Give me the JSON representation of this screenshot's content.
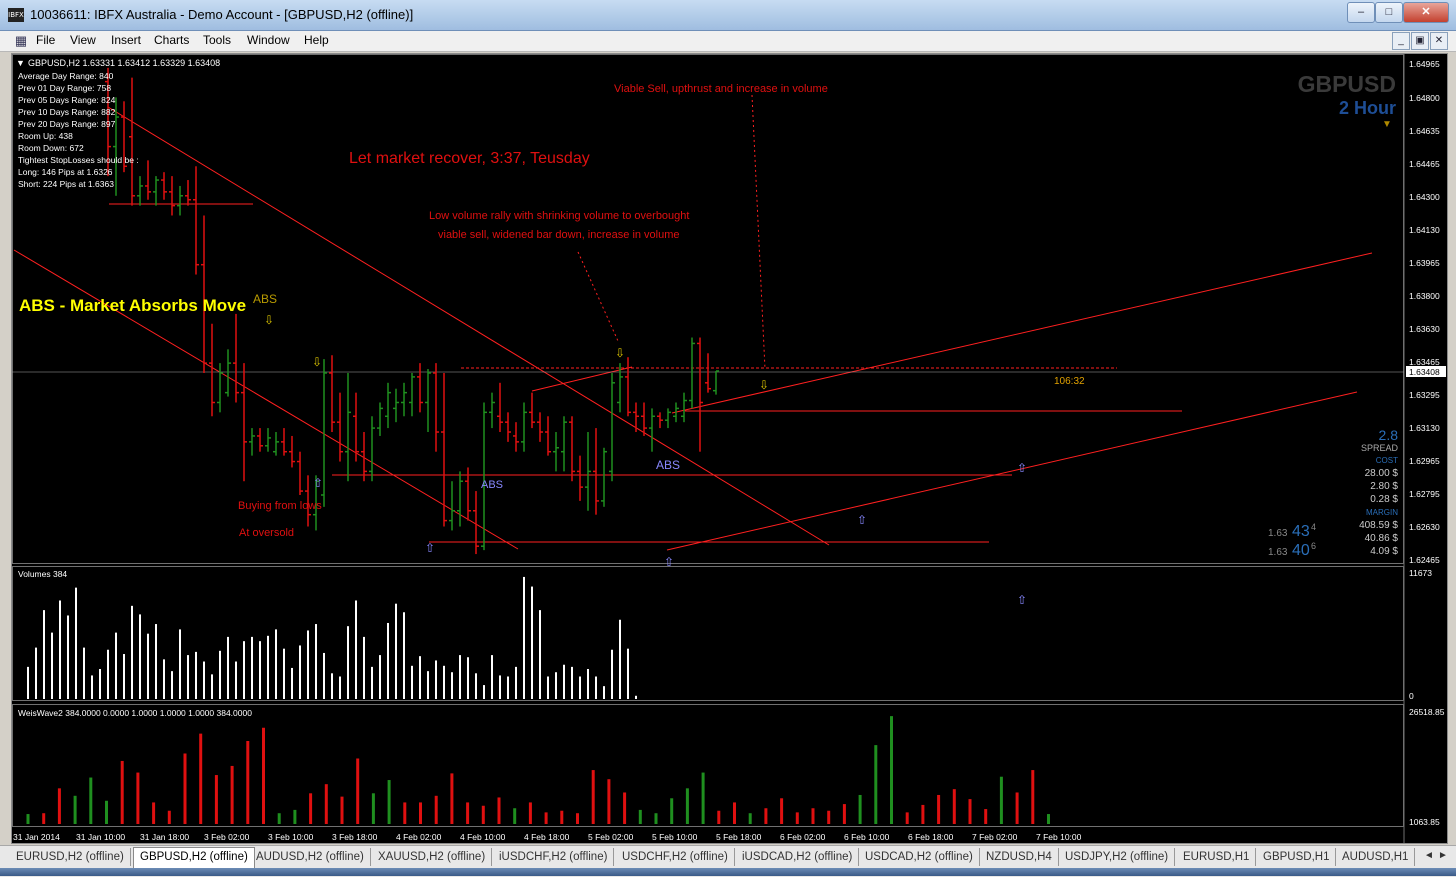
{
  "window": {
    "title": "10036611: IBFX Australia - Demo Account - [GBPUSD,H2 (offline)]",
    "app_icon_text": "IBFX",
    "minimize": "–",
    "maximize": "□",
    "close": "✕"
  },
  "menu": [
    "File",
    "View",
    "Insert",
    "Charts",
    "Tools",
    "Window",
    "Help"
  ],
  "mdi_buttons": {
    "minimize": "_",
    "restore": "▣",
    "close": "✕"
  },
  "chart": {
    "header": "GBPUSD,H2  1.63331 1.63412 1.63329 1.63408",
    "info_lines": [
      "Average Day   Range: 840",
      "Prev 01  Day   Range: 758",
      "Prev 05  Days Range: 824",
      "Prev 10  Days Range: 882",
      "Prev 20  Days Range: 897",
      "Room Up:      438",
      "Room Down: 672",
      "Tightest StopLosses should be :",
      "Long:  146 Pips at 1.6326",
      "Short: 224 Pips at 1.6363"
    ],
    "symbol_big": "GBPUSD",
    "timeframe_big": "2 Hour",
    "annotations": {
      "viable_sell": "Viable Sell, upthrust and increase in volume",
      "let_market": "Let market recover, 3:37, Teusday",
      "low_volume_1": "Low volume rally with shrinking volume to overbought",
      "low_volume_2": "viable sell, widened bar down, increase in volume",
      "abs_title": "ABS - Market Absorbs Move",
      "abs_small": "ABS",
      "abs_label_1": "ABS",
      "abs_label_2": "ABS",
      "buying": "Buying from lows",
      "oversold": "At oversold",
      "countdown": "106:32"
    },
    "price_axis": [
      "1.64965",
      "1.64800",
      "1.64635",
      "1.64465",
      "1.64300",
      "1.64130",
      "1.63965",
      "1.63800",
      "1.63630",
      "1.63465",
      "1.63295",
      "1.63130",
      "1.62965",
      "1.62795",
      "1.62630",
      "1.62465"
    ],
    "current_price": "1.63408",
    "spread_panel": {
      "spread_value": "2.8",
      "spread_label": "SPREAD",
      "cost_label": "COST",
      "cost_1": "28.00 $",
      "cost_2": "2.80 $",
      "cost_3": "0.28 $",
      "margin_label": "MARGIN",
      "margin_1": "408.59 $",
      "margin_2": "40.86 $",
      "margin_3": "4.09 $",
      "bid_prefix": "1.63",
      "bid_big": "43",
      "bid_small": "4",
      "ask_prefix": "1.63",
      "ask_big": "40",
      "ask_small": "6"
    },
    "volumes_label": "Volumes 384",
    "volumes_axis_top": "11673",
    "volumes_axis_bottom": "0",
    "weis_label": "WeisWave2 384.0000 0.0000 1.0000 1.0000 1.0000 384.0000",
    "weis_axis_top": "26518.85",
    "weis_axis_bottom": "1063.85",
    "time_axis": [
      "31 Jan 2014",
      "31 Jan 10:00",
      "31 Jan 18:00",
      "3 Feb 02:00",
      "3 Feb 10:00",
      "3 Feb 18:00",
      "4 Feb 02:00",
      "4 Feb 10:00",
      "4 Feb 18:00",
      "5 Feb 02:00",
      "5 Feb 10:00",
      "5 Feb 18:00",
      "6 Feb 02:00",
      "6 Feb 10:00",
      "6 Feb 18:00",
      "7 Feb 02:00",
      "7 Feb 10:00"
    ],
    "colors": {
      "up": "#1f8f1f",
      "down": "#e01010",
      "volume": "#ffffff",
      "line": "#ff2020",
      "abs_title": "#ffff00",
      "annot": "#e01010",
      "arrow_yellow": "#d8c000",
      "arrow_blue": "#8888ff"
    }
  },
  "chart_data": {
    "type": "bar",
    "symbol": "GBPUSD",
    "timeframe": "H2",
    "ohlc_header": {
      "open": 1.63331,
      "high": 1.63412,
      "low": 1.63329,
      "close": 1.63408
    },
    "categories": [
      "31 Jan 2014",
      "31 Jan 10:00",
      "31 Jan 18:00",
      "3 Feb 02:00",
      "3 Feb 10:00",
      "3 Feb 18:00",
      "4 Feb 02:00",
      "4 Feb 10:00",
      "4 Feb 18:00",
      "5 Feb 02:00",
      "5 Feb 10:00",
      "5 Feb 18:00",
      "6 Feb 02:00",
      "6 Feb 10:00",
      "6 Feb 18:00",
      "7 Feb 02:00",
      "7 Feb 10:00"
    ],
    "ylim": [
      1.6246,
      1.65
    ],
    "price_bars": [
      {
        "o": 1.6488,
        "h": 1.6495,
        "l": 1.644,
        "c": 1.6455
      },
      {
        "o": 1.6455,
        "h": 1.648,
        "l": 1.643,
        "c": 1.647
      },
      {
        "o": 1.647,
        "h": 1.6478,
        "l": 1.6442,
        "c": 1.6445
      },
      {
        "o": 1.646,
        "h": 1.649,
        "l": 1.6425,
        "c": 1.643
      },
      {
        "o": 1.643,
        "h": 1.644,
        "l": 1.6425,
        "c": 1.6435
      },
      {
        "o": 1.6435,
        "h": 1.6448,
        "l": 1.6428,
        "c": 1.6432
      },
      {
        "o": 1.6432,
        "h": 1.644,
        "l": 1.6425,
        "c": 1.6438
      },
      {
        "o": 1.6438,
        "h": 1.6442,
        "l": 1.6428,
        "c": 1.6432
      },
      {
        "o": 1.6432,
        "h": 1.644,
        "l": 1.642,
        "c": 1.6425
      },
      {
        "o": 1.6425,
        "h": 1.6435,
        "l": 1.642,
        "c": 1.643
      },
      {
        "o": 1.643,
        "h": 1.6438,
        "l": 1.6425,
        "c": 1.6428
      },
      {
        "o": 1.6428,
        "h": 1.6445,
        "l": 1.639,
        "c": 1.6395
      },
      {
        "o": 1.6395,
        "h": 1.642,
        "l": 1.634,
        "c": 1.6345
      },
      {
        "o": 1.6345,
        "h": 1.6365,
        "l": 1.6318,
        "c": 1.6325
      },
      {
        "o": 1.6325,
        "h": 1.6345,
        "l": 1.632,
        "c": 1.634
      },
      {
        "o": 1.633,
        "h": 1.6352,
        "l": 1.6328,
        "c": 1.6345
      },
      {
        "o": 1.6345,
        "h": 1.637,
        "l": 1.6325,
        "c": 1.633
      },
      {
        "o": 1.633,
        "h": 1.6345,
        "l": 1.6285,
        "c": 1.6305
      },
      {
        "o": 1.6305,
        "h": 1.6312,
        "l": 1.6298,
        "c": 1.6308
      },
      {
        "o": 1.6308,
        "h": 1.6312,
        "l": 1.63,
        "c": 1.6303
      },
      {
        "o": 1.6303,
        "h": 1.6312,
        "l": 1.63,
        "c": 1.6307
      },
      {
        "o": 1.63,
        "h": 1.631,
        "l": 1.6298,
        "c": 1.6305
      },
      {
        "o": 1.6305,
        "h": 1.6312,
        "l": 1.6298,
        "c": 1.63
      },
      {
        "o": 1.63,
        "h": 1.6308,
        "l": 1.6292,
        "c": 1.6295
      },
      {
        "o": 1.6295,
        "h": 1.63,
        "l": 1.6278,
        "c": 1.628
      },
      {
        "o": 1.628,
        "h": 1.6288,
        "l": 1.6262,
        "c": 1.6268
      },
      {
        "o": 1.6268,
        "h": 1.6288,
        "l": 1.626,
        "c": 1.6285
      },
      {
        "o": 1.6278,
        "h": 1.6347,
        "l": 1.6272,
        "c": 1.634
      },
      {
        "o": 1.634,
        "h": 1.6349,
        "l": 1.631,
        "c": 1.6315
      },
      {
        "o": 1.6315,
        "h": 1.633,
        "l": 1.6295,
        "c": 1.63
      },
      {
        "o": 1.63,
        "h": 1.634,
        "l": 1.6285,
        "c": 1.632
      },
      {
        "o": 1.6318,
        "h": 1.633,
        "l": 1.6295,
        "c": 1.63
      },
      {
        "o": 1.63,
        "h": 1.631,
        "l": 1.6285,
        "c": 1.629
      },
      {
        "o": 1.629,
        "h": 1.6318,
        "l": 1.6285,
        "c": 1.6312
      },
      {
        "o": 1.6312,
        "h": 1.6325,
        "l": 1.6308,
        "c": 1.6322
      },
      {
        "o": 1.6318,
        "h": 1.6335,
        "l": 1.6312,
        "c": 1.633
      },
      {
        "o": 1.6322,
        "h": 1.6332,
        "l": 1.6315,
        "c": 1.6325
      },
      {
        "o": 1.6325,
        "h": 1.6335,
        "l": 1.6318,
        "c": 1.633
      },
      {
        "o": 1.6325,
        "h": 1.634,
        "l": 1.6318,
        "c": 1.6338
      },
      {
        "o": 1.6338,
        "h": 1.6345,
        "l": 1.632,
        "c": 1.6325
      },
      {
        "o": 1.6325,
        "h": 1.6342,
        "l": 1.631,
        "c": 1.634
      },
      {
        "o": 1.634,
        "h": 1.6345,
        "l": 1.63,
        "c": 1.631
      },
      {
        "o": 1.631,
        "h": 1.634,
        "l": 1.6262,
        "c": 1.6265
      },
      {
        "o": 1.6265,
        "h": 1.6285,
        "l": 1.626,
        "c": 1.627
      },
      {
        "o": 1.627,
        "h": 1.629,
        "l": 1.6262,
        "c": 1.6285
      },
      {
        "o": 1.6285,
        "h": 1.6292,
        "l": 1.6265,
        "c": 1.627
      },
      {
        "o": 1.627,
        "h": 1.628,
        "l": 1.6248,
        "c": 1.6252
      },
      {
        "o": 1.6252,
        "h": 1.6325,
        "l": 1.625,
        "c": 1.632
      },
      {
        "o": 1.632,
        "h": 1.633,
        "l": 1.6312,
        "c": 1.6325
      },
      {
        "o": 1.6318,
        "h": 1.6335,
        "l": 1.631,
        "c": 1.6315
      },
      {
        "o": 1.6315,
        "h": 1.632,
        "l": 1.6305,
        "c": 1.631
      },
      {
        "o": 1.6308,
        "h": 1.6315,
        "l": 1.63,
        "c": 1.6305
      },
      {
        "o": 1.6305,
        "h": 1.6325,
        "l": 1.63,
        "c": 1.632
      },
      {
        "o": 1.632,
        "h": 1.633,
        "l": 1.6312,
        "c": 1.6315
      },
      {
        "o": 1.6315,
        "h": 1.632,
        "l": 1.6305,
        "c": 1.631
      },
      {
        "o": 1.631,
        "h": 1.6318,
        "l": 1.6298,
        "c": 1.63
      },
      {
        "o": 1.63,
        "h": 1.631,
        "l": 1.629,
        "c": 1.6302
      },
      {
        "o": 1.63,
        "h": 1.6318,
        "l": 1.629,
        "c": 1.6315
      },
      {
        "o": 1.6315,
        "h": 1.6318,
        "l": 1.6285,
        "c": 1.629
      },
      {
        "o": 1.629,
        "h": 1.6298,
        "l": 1.6275,
        "c": 1.6282
      },
      {
        "o": 1.6282,
        "h": 1.631,
        "l": 1.627,
        "c": 1.629
      },
      {
        "o": 1.629,
        "h": 1.6312,
        "l": 1.6268,
        "c": 1.6275
      },
      {
        "o": 1.6275,
        "h": 1.6302,
        "l": 1.6272,
        "c": 1.63
      },
      {
        "o": 1.629,
        "h": 1.634,
        "l": 1.6285,
        "c": 1.6335
      },
      {
        "o": 1.6325,
        "h": 1.6345,
        "l": 1.632,
        "c": 1.6338
      },
      {
        "o": 1.6338,
        "h": 1.6348,
        "l": 1.6318,
        "c": 1.632
      },
      {
        "o": 1.632,
        "h": 1.6325,
        "l": 1.631,
        "c": 1.6318
      },
      {
        "o": 1.6318,
        "h": 1.6325,
        "l": 1.6308,
        "c": 1.6312
      },
      {
        "o": 1.6312,
        "h": 1.6322,
        "l": 1.63,
        "c": 1.6318
      },
      {
        "o": 1.6318,
        "h": 1.632,
        "l": 1.6312,
        "c": 1.6316
      },
      {
        "o": 1.6316,
        "h": 1.6322,
        "l": 1.6312,
        "c": 1.632
      },
      {
        "o": 1.6318,
        "h": 1.6325,
        "l": 1.6315,
        "c": 1.6322
      },
      {
        "o": 1.6318,
        "h": 1.633,
        "l": 1.6315,
        "c": 1.6326
      },
      {
        "o": 1.6326,
        "h": 1.6358,
        "l": 1.6322,
        "c": 1.6355
      },
      {
        "o": 1.6355,
        "h": 1.6358,
        "l": 1.63,
        "c": 1.6325
      },
      {
        "o": 1.6335,
        "h": 1.635,
        "l": 1.633,
        "c": 1.6332
      },
      {
        "o": 1.6331,
        "h": 1.6341,
        "l": 1.6329,
        "c": 1.6341
      }
    ],
    "volumes": [
      3000,
      4800,
      8300,
      6200,
      9200,
      7800,
      10400,
      4800,
      2200,
      2800,
      4600,
      6200,
      4200,
      8700,
      7900,
      6100,
      7000,
      3700,
      2600,
      6500,
      4100,
      4400,
      3500,
      2300,
      4500,
      5800,
      3500,
      5400,
      5800,
      5400,
      5900,
      6500,
      4700,
      2900,
      5000,
      6400,
      7000,
      4300,
      2400,
      2100,
      6800,
      9200,
      5800,
      3000,
      4100,
      7100,
      8900,
      8100,
      3100,
      4000,
      2600,
      3600,
      3100,
      2500,
      4100,
      3900,
      2400,
      1300,
      4100,
      2200,
      2100,
      3000,
      11400,
      10500,
      8300,
      2100,
      2500,
      3200,
      3000,
      2100,
      2800,
      2100,
      1200,
      4600,
      7400,
      4700,
      300
    ],
    "weiswave": [
      {
        "v": 1200,
        "dir": "up"
      },
      {
        "v": 1300,
        "dir": "down"
      },
      {
        "v": 4300,
        "dir": "down"
      },
      {
        "v": 3400,
        "dir": "up"
      },
      {
        "v": 5600,
        "dir": "up"
      },
      {
        "v": 2800,
        "dir": "up"
      },
      {
        "v": 7600,
        "dir": "down"
      },
      {
        "v": 6200,
        "dir": "down"
      },
      {
        "v": 2600,
        "dir": "down"
      },
      {
        "v": 1600,
        "dir": "down"
      },
      {
        "v": 8500,
        "dir": "down"
      },
      {
        "v": 10900,
        "dir": "down"
      },
      {
        "v": 5900,
        "dir": "down"
      },
      {
        "v": 7000,
        "dir": "down"
      },
      {
        "v": 10000,
        "dir": "down"
      },
      {
        "v": 11600,
        "dir": "down"
      },
      {
        "v": 1300,
        "dir": "up"
      },
      {
        "v": 1700,
        "dir": "up"
      },
      {
        "v": 3700,
        "dir": "down"
      },
      {
        "v": 4800,
        "dir": "down"
      },
      {
        "v": 3300,
        "dir": "down"
      },
      {
        "v": 7900,
        "dir": "down"
      },
      {
        "v": 3700,
        "dir": "up"
      },
      {
        "v": 5300,
        "dir": "up"
      },
      {
        "v": 2600,
        "dir": "down"
      },
      {
        "v": 2600,
        "dir": "down"
      },
      {
        "v": 3400,
        "dir": "down"
      },
      {
        "v": 6100,
        "dir": "down"
      },
      {
        "v": 2600,
        "dir": "down"
      },
      {
        "v": 2200,
        "dir": "down"
      },
      {
        "v": 3200,
        "dir": "down"
      },
      {
        "v": 1900,
        "dir": "up"
      },
      {
        "v": 2600,
        "dir": "down"
      },
      {
        "v": 1400,
        "dir": "down"
      },
      {
        "v": 1600,
        "dir": "down"
      },
      {
        "v": 1300,
        "dir": "down"
      },
      {
        "v": 6500,
        "dir": "down"
      },
      {
        "v": 5400,
        "dir": "down"
      },
      {
        "v": 3800,
        "dir": "down"
      },
      {
        "v": 1700,
        "dir": "up"
      },
      {
        "v": 1300,
        "dir": "up"
      },
      {
        "v": 3100,
        "dir": "up"
      },
      {
        "v": 4300,
        "dir": "up"
      },
      {
        "v": 6200,
        "dir": "up"
      },
      {
        "v": 1600,
        "dir": "down"
      },
      {
        "v": 2600,
        "dir": "down"
      },
      {
        "v": 1300,
        "dir": "up"
      },
      {
        "v": 1900,
        "dir": "down"
      },
      {
        "v": 3100,
        "dir": "down"
      },
      {
        "v": 1400,
        "dir": "down"
      },
      {
        "v": 1900,
        "dir": "down"
      },
      {
        "v": 1600,
        "dir": "down"
      },
      {
        "v": 2400,
        "dir": "down"
      },
      {
        "v": 3500,
        "dir": "up"
      },
      {
        "v": 9500,
        "dir": "up"
      },
      {
        "v": 13000,
        "dir": "up"
      },
      {
        "v": 1400,
        "dir": "down"
      },
      {
        "v": 2300,
        "dir": "down"
      },
      {
        "v": 3500,
        "dir": "down"
      },
      {
        "v": 4200,
        "dir": "down"
      },
      {
        "v": 3000,
        "dir": "down"
      },
      {
        "v": 1800,
        "dir": "down"
      },
      {
        "v": 5700,
        "dir": "up"
      },
      {
        "v": 3800,
        "dir": "down"
      },
      {
        "v": 6500,
        "dir": "down"
      },
      {
        "v": 1200,
        "dir": "up"
      }
    ]
  },
  "tabs": [
    "EURUSD,H2 (offline)",
    "GBPUSD,H2 (offline)",
    "AUDUSD,H2 (offline)",
    "XAUUSD,H2 (offline)",
    "iUSDCHF,H2 (offline)",
    "USDCHF,H2 (offline)",
    "iUSDCAD,H2 (offline)",
    "USDCAD,H2 (offline)",
    "NZDUSD,H4",
    "USDJPY,H2 (offline)",
    "EURUSD,H1",
    "GBPUSD,H1",
    "AUDUSD,H1"
  ],
  "active_tab": 1,
  "tab_nav": {
    "prev": "◄",
    "next": "►"
  }
}
